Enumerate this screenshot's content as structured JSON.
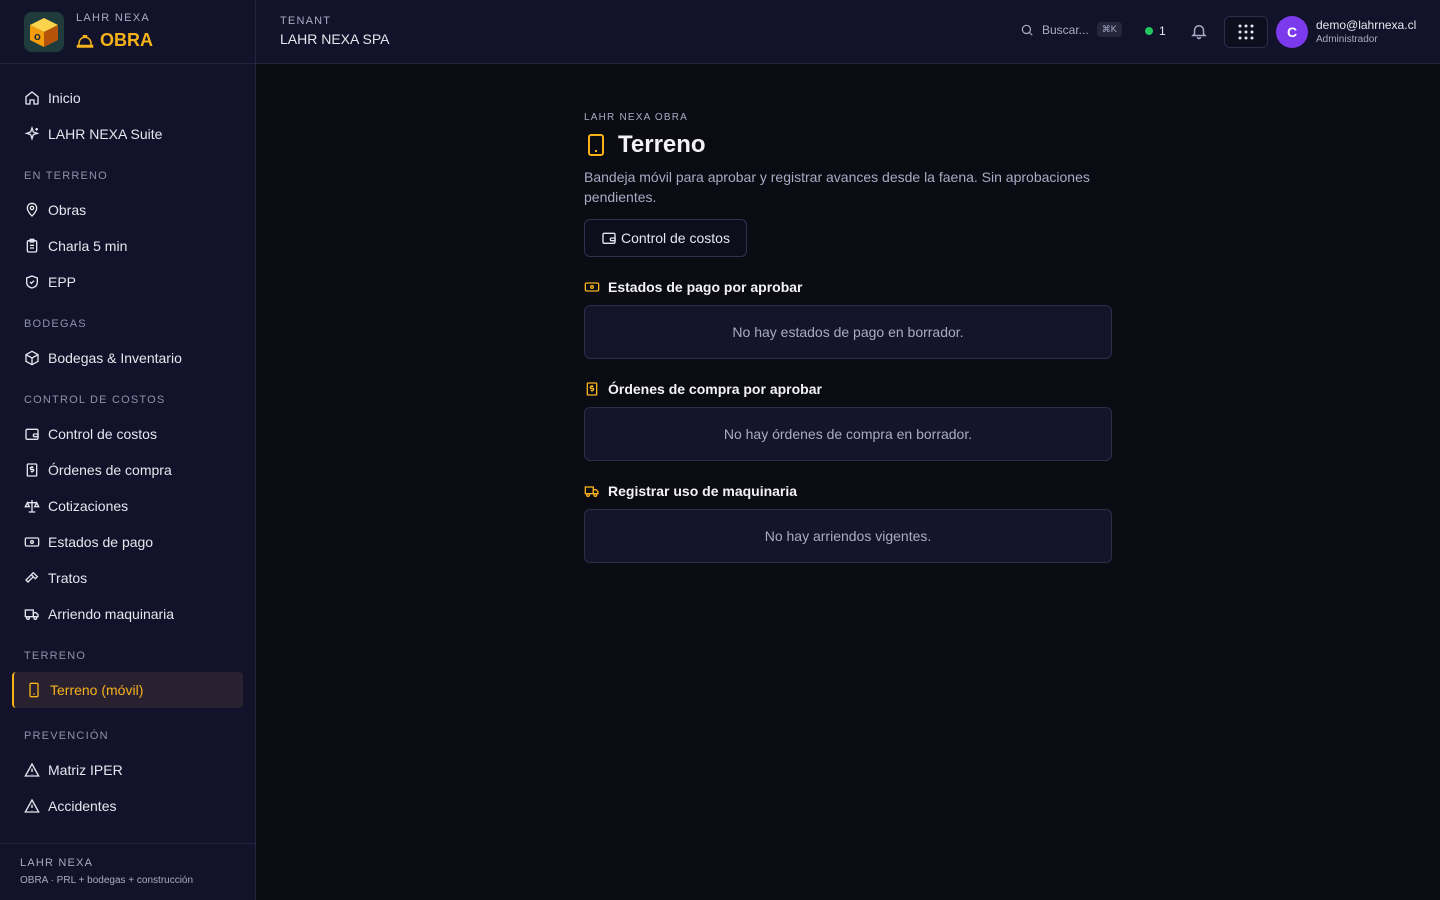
{
  "brand": {
    "sub": "LAHR NEXA",
    "main": "OBRA"
  },
  "nav": {
    "top": [
      {
        "label": "Inicio",
        "icon": "home-icon"
      },
      {
        "label": "LAHR NEXA Suite",
        "icon": "sparkle-icon"
      }
    ],
    "sections": {
      "en_terreno": "EN TERRENO",
      "bodegas": "BODEGAS",
      "control": "CONTROL DE COSTOS",
      "terreno": "TERRENO",
      "prevencion": "PREVENCIÓN"
    },
    "en_terreno": [
      {
        "label": "Obras"
      },
      {
        "label": "Charla 5 min"
      },
      {
        "label": "EPP"
      }
    ],
    "bodegas": [
      {
        "label": "Bodegas & Inventario"
      }
    ],
    "control": [
      {
        "label": "Control de costos"
      },
      {
        "label": "Órdenes de compra"
      },
      {
        "label": "Cotizaciones"
      },
      {
        "label": "Estados de pago"
      },
      {
        "label": "Tratos"
      },
      {
        "label": "Arriendo maquinaria"
      }
    ],
    "terreno": [
      {
        "label": "Terreno (móvil)",
        "active": true
      }
    ],
    "prevencion": [
      {
        "label": "Matriz IPER"
      },
      {
        "label": "Accidentes"
      }
    ]
  },
  "sidebar_footer": {
    "title": "LAHR NEXA",
    "sub": "OBRA · PRL + bodegas + construcción"
  },
  "topbar": {
    "tenant_label": "TENANT",
    "tenant_name": "LAHR NEXA SPA",
    "search_placeholder": "Buscar...",
    "search_shortcut": "⌘K",
    "status_count": "1",
    "avatar_initial": "C",
    "user_email": "demo@lahrnexa.cl",
    "user_role": "Administrador"
  },
  "page": {
    "eyebrow": "LAHR NEXA OBRA",
    "title": "Terreno",
    "description": "Bandeja móvil para aprobar y registrar avances desde la faena. Sin aprobaciones pendientes.",
    "cost_button": "Control de costos",
    "sections": [
      {
        "title": "Estados de pago por aprobar",
        "empty": "No hay estados de pago en borrador."
      },
      {
        "title": "Órdenes de compra por aprobar",
        "empty": "No hay órdenes de compra en borrador."
      },
      {
        "title": "Registrar uso de maquinaria",
        "empty": "No hay arriendos vigentes."
      }
    ]
  },
  "colors": {
    "accent": "#f5b21b",
    "avatar": "#7c3aed",
    "status": "#22c55e",
    "bg": "#0b0b14",
    "panel": "#12132a"
  }
}
